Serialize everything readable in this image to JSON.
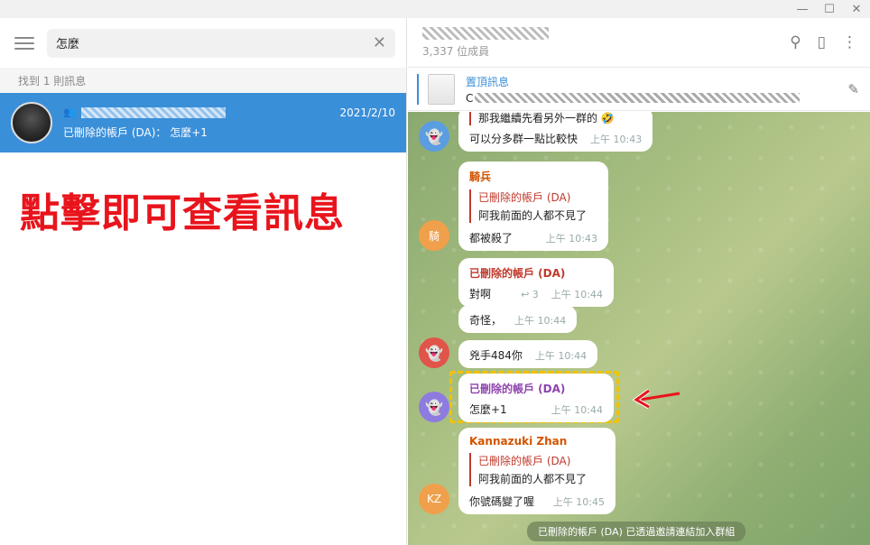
{
  "window": {
    "minimize": "—",
    "maximize": "☐",
    "close": "✕"
  },
  "search": {
    "query": "怎麼",
    "result_count": "找到 1 則訊息"
  },
  "result": {
    "date": "2021/2/10",
    "preview": "已刪除的帳戶 (DA)： 怎麼+1"
  },
  "annotation": "點擊即可查看訊息",
  "header": {
    "member_count": "3,337 位成員"
  },
  "pinned": {
    "title": "置頂訊息",
    "preview_prefix": "C"
  },
  "messages": [
    {
      "text1": "那我繼續先看另外一群的",
      "emoji": "🤣",
      "text2": "可以分多群一點比較快",
      "time": "上午 10:43"
    },
    {
      "sender": "騎兵",
      "reply_name": "已刪除的帳戶 (DA)",
      "reply_text": "阿我前面的人都不見了",
      "text": "都被殺了",
      "time": "上午 10:43",
      "avatar": "騎"
    },
    {
      "sender": "已刪除的帳戶 (DA)",
      "text": "對啊",
      "reply_count": "3",
      "time": "上午 10:44"
    },
    {
      "text": "奇怪，",
      "time": "上午 10:44"
    },
    {
      "text": "兇手484你",
      "time": "上午 10:44"
    },
    {
      "sender": "已刪除的帳戶 (DA)",
      "text": "怎麼+1",
      "time": "上午 10:44"
    },
    {
      "sender": "Kannazuki Zhan",
      "reply_name": "已刪除的帳戶 (DA)",
      "reply_text": "阿我前面的人都不見了",
      "text": "你號碼變了喔",
      "time": "上午 10:45",
      "avatar": "KZ"
    }
  ],
  "service": "已刪除的帳戶 (DA) 已透過邀請連結加入群組",
  "colors": {
    "accent": "#3a8fd9",
    "annotation": "#e8141c",
    "highlight": "#f2c200"
  }
}
